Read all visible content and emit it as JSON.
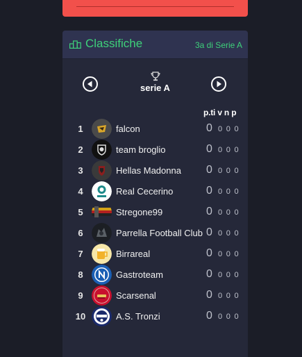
{
  "header": {
    "icon": "podium-icon",
    "title": "Classifiche",
    "subtitle": "3a di Serie A"
  },
  "nav": {
    "prev_icon": "arrow-left-circle-icon",
    "next_icon": "arrow-right-circle-icon",
    "trophy_icon": "trophy-icon",
    "league": "serie A"
  },
  "table": {
    "columns": "p.ti v n p",
    "rows": [
      {
        "rank": "1",
        "team": "falcon",
        "points": "0",
        "stats": "0 0 0"
      },
      {
        "rank": "2",
        "team": "team broglio",
        "points": "0",
        "stats": "0 0 0"
      },
      {
        "rank": "3",
        "team": "Hellas Madonna",
        "points": "0",
        "stats": "0 0 0"
      },
      {
        "rank": "4",
        "team": "Real Cecerino",
        "points": "0",
        "stats": "0 0 0"
      },
      {
        "rank": "5",
        "team": "Stregone99",
        "points": "0",
        "stats": "0 0 0"
      },
      {
        "rank": "6",
        "team": "Parrella Football Club",
        "points": "0",
        "stats": "0 0 0"
      },
      {
        "rank": "7",
        "team": "Birrareal",
        "points": "0",
        "stats": "0 0 0"
      },
      {
        "rank": "8",
        "team": "Gastroteam",
        "points": "0",
        "stats": "0 0 0"
      },
      {
        "rank": "9",
        "team": "Scarsenal",
        "points": "0",
        "stats": "0 0 0"
      },
      {
        "rank": "10",
        "team": "A.S. Tronzi",
        "points": "0",
        "stats": "0 0 0"
      }
    ]
  },
  "colors": {
    "accent_green": "#3ed17a",
    "red_card": "#f2504b",
    "card_bg": "#252839",
    "header_bg": "#2f3350"
  }
}
